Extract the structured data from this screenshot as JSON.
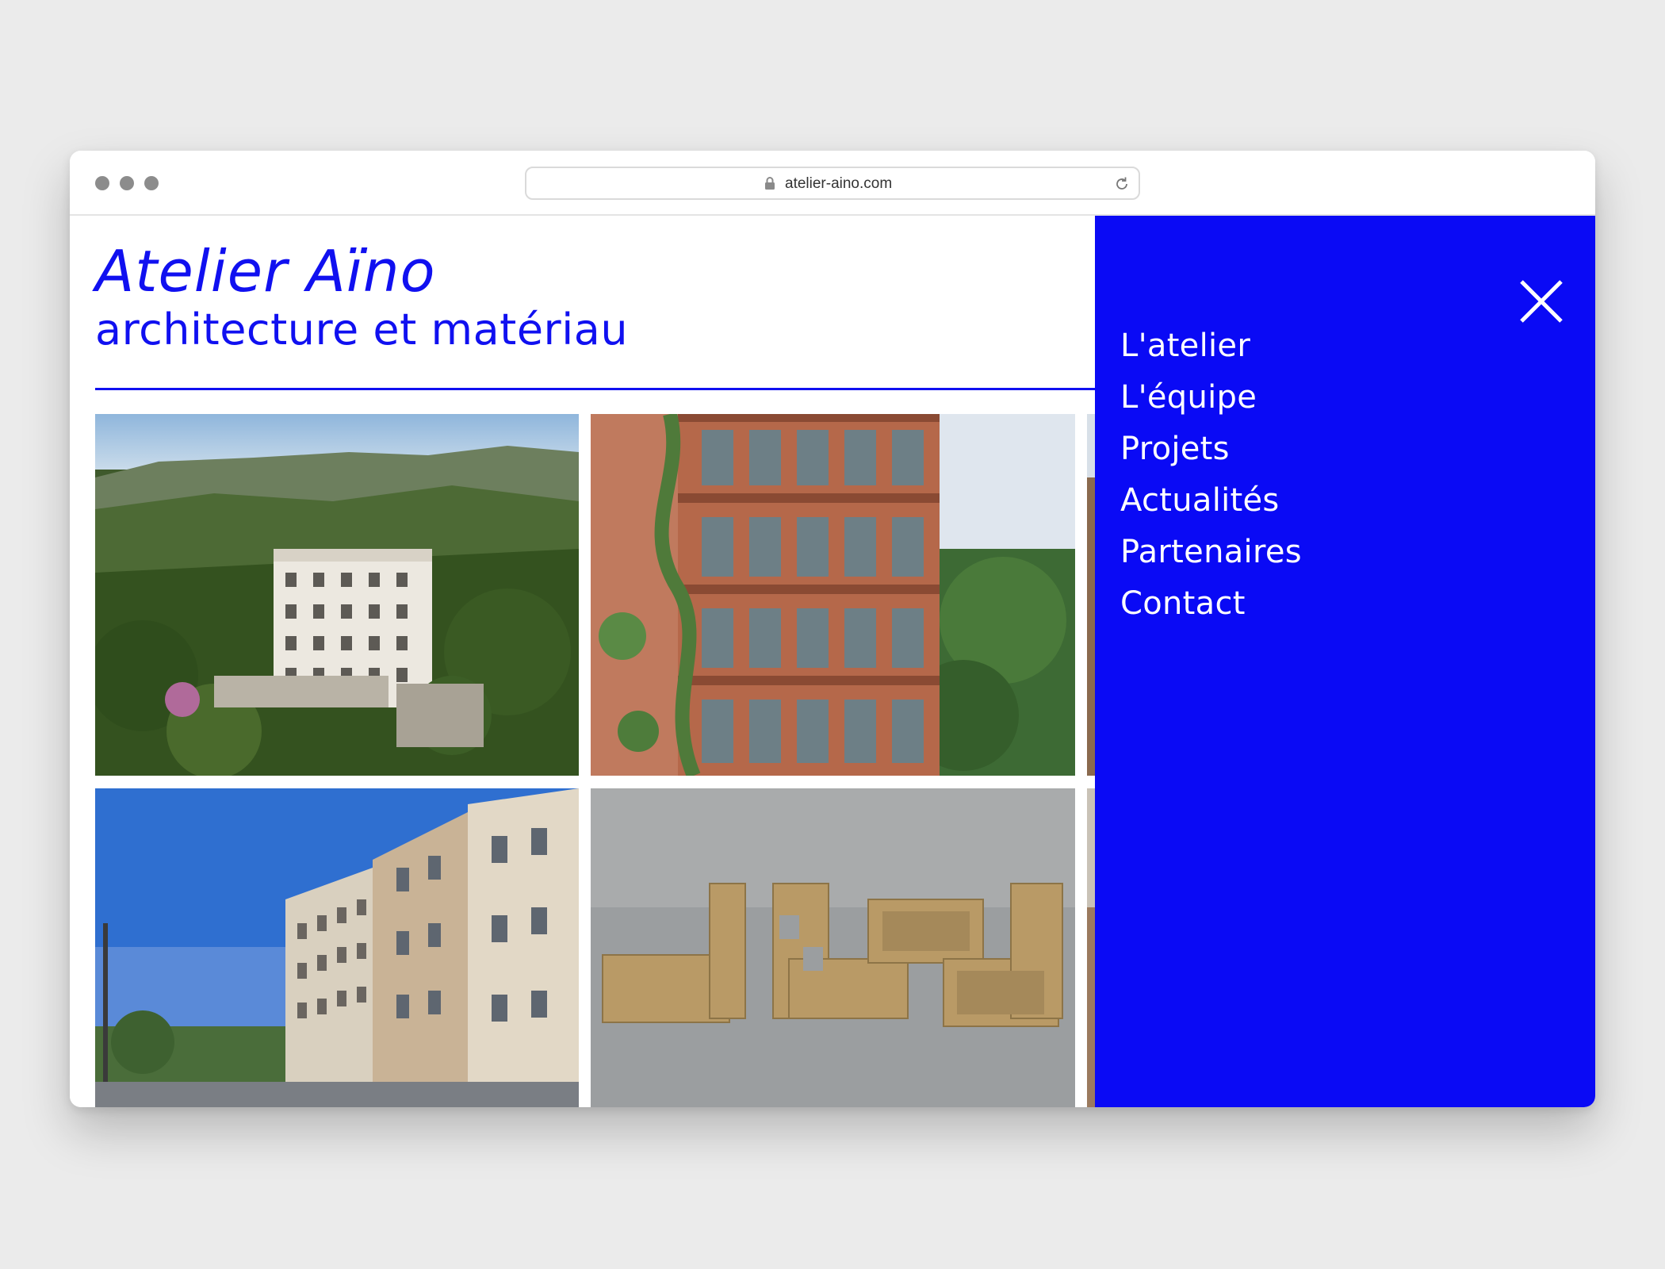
{
  "browser": {
    "url": "atelier-aino.com",
    "icons": [
      "lock-icon",
      "reload-icon"
    ]
  },
  "site": {
    "title": "Atelier Aïno",
    "subtitle": "architecture et matériau"
  },
  "menu": {
    "close_icon": "close-icon",
    "items": [
      {
        "label": "L'atelier"
      },
      {
        "label": "L'équipe"
      },
      {
        "label": "Projets"
      },
      {
        "label": "Actualités"
      },
      {
        "label": "Partenaires"
      },
      {
        "label": "Contact"
      }
    ]
  },
  "colors": {
    "brand_blue": "#0a0af5",
    "menu_text": "#ffffff",
    "background": "#ebebeb"
  }
}
